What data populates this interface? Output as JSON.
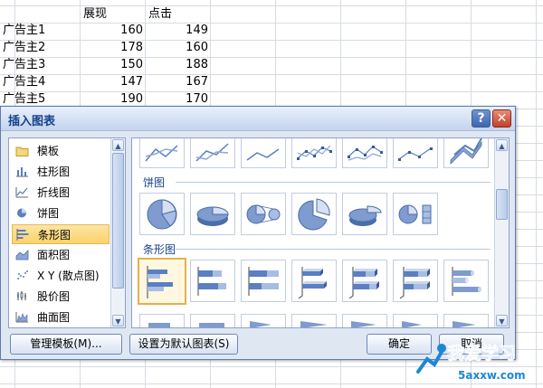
{
  "sheet": {
    "headers": [
      "展现",
      "点击"
    ],
    "rows": [
      {
        "label": "广告主1",
        "impressions": "160",
        "clicks": "149"
      },
      {
        "label": "广告主2",
        "impressions": "178",
        "clicks": "160"
      },
      {
        "label": "广告主3",
        "impressions": "150",
        "clicks": "188"
      },
      {
        "label": "广告主4",
        "impressions": "147",
        "clicks": "167"
      },
      {
        "label": "广告主5",
        "impressions": "190",
        "clicks": "170"
      }
    ]
  },
  "dialog": {
    "title": "插入图表",
    "help_label": "?",
    "close_label": "✕",
    "categories": [
      {
        "label": "模板",
        "icon": "folder-icon"
      },
      {
        "label": "柱形图",
        "icon": "column-chart-icon"
      },
      {
        "label": "折线图",
        "icon": "line-chart-icon"
      },
      {
        "label": "饼图",
        "icon": "pie-chart-icon"
      },
      {
        "label": "条形图",
        "icon": "bar-chart-icon",
        "selected": true
      },
      {
        "label": "面积图",
        "icon": "area-chart-icon"
      },
      {
        "label": "X Y (散点图)",
        "icon": "scatter-chart-icon"
      },
      {
        "label": "股价图",
        "icon": "stock-chart-icon"
      },
      {
        "label": "曲面图",
        "icon": "surface-chart-icon"
      }
    ],
    "sections": {
      "pie": "饼图",
      "bar": "条形图"
    },
    "buttons": {
      "manage_templates": "管理模板(M)...",
      "set_default": "设置为默认图表(S)",
      "ok": "确定",
      "cancel": "取消"
    }
  },
  "watermark": {
    "text": "我爱学习",
    "site": "5axxw.com"
  },
  "colors": {
    "dialog_bg": "#dfe7f3",
    "title_text": "#15428b",
    "selection": "#fbd26b",
    "chart_blue": "#5b7fc0"
  }
}
